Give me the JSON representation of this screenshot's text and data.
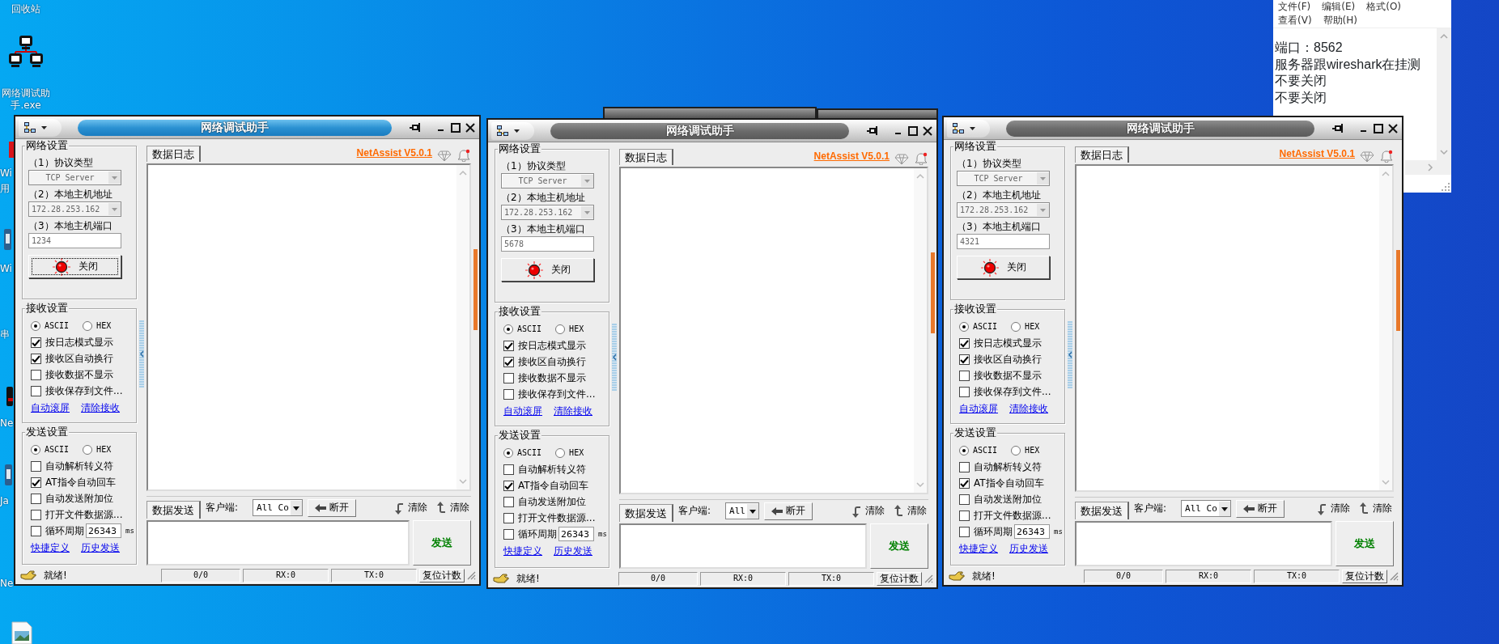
{
  "desktop": {
    "icons": [
      {
        "label": "回收站"
      },
      {
        "label": "网络调试助手.exe",
        "kind": "network"
      },
      {
        "kind": "red-app"
      },
      {
        "label": "Wi"
      },
      {
        "label": "用"
      },
      {
        "kind": "blue-app"
      },
      {
        "label": "Wi"
      },
      {
        "label": "串"
      },
      {
        "kind": "dark-app"
      },
      {
        "label": "Ne"
      },
      {
        "kind": "blue-app"
      },
      {
        "label": "Ja"
      },
      {
        "label": "Ne"
      },
      {
        "kind": "image"
      }
    ]
  },
  "windows": [
    {
      "title": "网络调试助手",
      "active": true,
      "brand": "NetAssist V5.0.1",
      "log_tab": "数据日志",
      "network_settings": {
        "legend": "网络设置",
        "fields": [
          {
            "label": "（1）协议类型",
            "kind": "select",
            "value": "TCP Server"
          },
          {
            "label": "（2）本地主机地址",
            "kind": "select",
            "value": "172.28.253.162"
          },
          {
            "label": "（3）本地主机端口",
            "kind": "input",
            "value": "1234"
          }
        ],
        "toggle": {
          "label": "关闭",
          "focused": true
        }
      },
      "receive_settings": {
        "legend": "接收设置",
        "encodings": [
          {
            "label": "ASCII",
            "selected": true
          },
          {
            "label": "HEX",
            "selected": false
          }
        ],
        "options": [
          {
            "kind": "check",
            "label": "按日志模式显示",
            "checked": true
          },
          {
            "kind": "check",
            "label": "接收区自动换行",
            "checked": true
          },
          {
            "kind": "check",
            "label": "接收数据不显示",
            "checked": false
          },
          {
            "kind": "check",
            "label": "接收保存到文件...",
            "checked": false
          }
        ],
        "links": [
          "自动滚屏",
          "清除接收"
        ]
      },
      "send_settings": {
        "legend": "发送设置",
        "encodings": [
          {
            "label": "ASCII",
            "selected": true
          },
          {
            "label": "HEX",
            "selected": false
          }
        ],
        "options": [
          {
            "kind": "check",
            "label": "自动解析转义符",
            "checked": false
          },
          {
            "kind": "check",
            "label": "AT指令自动回车",
            "checked": true
          },
          {
            "kind": "check",
            "label": "自动发送附加位",
            "checked": false
          },
          {
            "kind": "check",
            "label": "打开文件数据源...",
            "checked": false
          },
          {
            "kind": "period",
            "label": "循环周期",
            "checked": false,
            "value": "26343",
            "unit": "ms"
          }
        ],
        "links": [
          "快捷定义",
          "历史发送"
        ]
      },
      "send_bar": {
        "tab": "数据发送",
        "client_label": "客户端:",
        "client_value": "All Co",
        "disconnect": "断开",
        "clear_buttons": [
          "清除",
          "清除"
        ]
      },
      "send_button": "发送",
      "status": {
        "message": "就绪!",
        "counters": [
          "0/0",
          "RX:0",
          "TX:0"
        ],
        "reset": "复位计数"
      }
    },
    {
      "title": "网络调试助手",
      "active": false,
      "brand": "NetAssist V5.0.1",
      "log_tab": "数据日志",
      "network_settings": {
        "legend": "网络设置",
        "fields": [
          {
            "label": "（1）协议类型",
            "kind": "select",
            "value": "TCP Server"
          },
          {
            "label": "（2）本地主机地址",
            "kind": "select",
            "value": "172.28.253.162"
          },
          {
            "label": "（3）本地主机端口",
            "kind": "input",
            "value": "5678"
          }
        ],
        "toggle": {
          "label": "关闭",
          "focused": false
        }
      },
      "receive_settings": {
        "legend": "接收设置",
        "encodings": [
          {
            "label": "ASCII",
            "selected": true
          },
          {
            "label": "HEX",
            "selected": false
          }
        ],
        "options": [
          {
            "kind": "check",
            "label": "按日志模式显示",
            "checked": true
          },
          {
            "kind": "check",
            "label": "接收区自动换行",
            "checked": true
          },
          {
            "kind": "check",
            "label": "接收数据不显示",
            "checked": false
          },
          {
            "kind": "check",
            "label": "接收保存到文件...",
            "checked": false
          }
        ],
        "links": [
          "自动滚屏",
          "清除接收"
        ]
      },
      "send_settings": {
        "legend": "发送设置",
        "encodings": [
          {
            "label": "ASCII",
            "selected": true
          },
          {
            "label": "HEX",
            "selected": false
          }
        ],
        "options": [
          {
            "kind": "check",
            "label": "自动解析转义符",
            "checked": false
          },
          {
            "kind": "check",
            "label": "AT指令自动回车",
            "checked": true
          },
          {
            "kind": "check",
            "label": "自动发送附加位",
            "checked": false
          },
          {
            "kind": "check",
            "label": "打开文件数据源...",
            "checked": false
          },
          {
            "kind": "period",
            "label": "循环周期",
            "checked": false,
            "value": "26343",
            "unit": "ms"
          }
        ],
        "links": [
          "快捷定义",
          "历史发送"
        ]
      },
      "send_bar": {
        "tab": "数据发送",
        "client_label": "客户端:",
        "client_value": "All",
        "disconnect": "断开",
        "clear_buttons": [
          "清除",
          "清除"
        ]
      },
      "send_button": "发送",
      "status": {
        "message": "就绪!",
        "counters": [
          "0/0",
          "RX:0",
          "TX:0"
        ],
        "reset": "复位计数"
      }
    },
    {
      "title": "网络调试助手",
      "active": false,
      "brand": "NetAssist V5.0.1",
      "log_tab": "数据日志",
      "network_settings": {
        "legend": "网络设置",
        "fields": [
          {
            "label": "（1）协议类型",
            "kind": "select",
            "value": "TCP Server"
          },
          {
            "label": "（2）本地主机地址",
            "kind": "select",
            "value": "172.28.253.162"
          },
          {
            "label": "（3）本地主机端口",
            "kind": "input",
            "value": "4321"
          }
        ],
        "toggle": {
          "label": "关闭",
          "focused": false
        }
      },
      "receive_settings": {
        "legend": "接收设置",
        "encodings": [
          {
            "label": "ASCII",
            "selected": true
          },
          {
            "label": "HEX",
            "selected": false
          }
        ],
        "options": [
          {
            "kind": "check",
            "label": "按日志模式显示",
            "checked": true
          },
          {
            "kind": "check",
            "label": "接收区自动换行",
            "checked": true
          },
          {
            "kind": "check",
            "label": "接收数据不显示",
            "checked": false
          },
          {
            "kind": "check",
            "label": "接收保存到文件...",
            "checked": false
          }
        ],
        "links": [
          "自动滚屏",
          "清除接收"
        ]
      },
      "send_settings": {
        "legend": "发送设置",
        "encodings": [
          {
            "label": "ASCII",
            "selected": true
          },
          {
            "label": "HEX",
            "selected": false
          }
        ],
        "options": [
          {
            "kind": "check",
            "label": "自动解析转义符",
            "checked": false
          },
          {
            "kind": "check",
            "label": "AT指令自动回车",
            "checked": true
          },
          {
            "kind": "check",
            "label": "自动发送附加位",
            "checked": false
          },
          {
            "kind": "check",
            "label": "打开文件数据源...",
            "checked": false
          },
          {
            "kind": "period",
            "label": "循环周期",
            "checked": false,
            "value": "26343",
            "unit": "ms"
          }
        ],
        "links": [
          "快捷定义",
          "历史发送"
        ]
      },
      "send_bar": {
        "tab": "数据发送",
        "client_label": "客户端:",
        "client_value": "All Co",
        "disconnect": "断开",
        "clear_buttons": [
          "清除",
          "清除"
        ]
      },
      "send_button": "发送",
      "status": {
        "message": "就绪!",
        "counters": [
          "0/0",
          "RX:0",
          "TX:0"
        ],
        "reset": "复位计数"
      }
    }
  ],
  "notepad": {
    "menu": [
      "文件(F)",
      "编辑(E)",
      "格式(O)",
      "查看(V)",
      "帮助(H)"
    ],
    "lines": [
      "端口：8562",
      "服务器跟wireshark在挂测",
      "不要关闭",
      "不要关闭"
    ]
  }
}
